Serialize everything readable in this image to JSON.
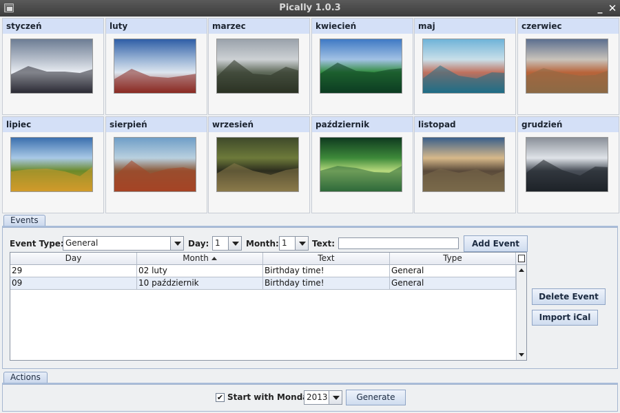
{
  "window": {
    "title": "Pically 1.0.3"
  },
  "months": [
    {
      "name": "styczeń",
      "colors": [
        "#6d7d94",
        "#b7bfcb",
        "#e9edf3",
        "#2b2b35"
      ]
    },
    {
      "name": "luty",
      "colors": [
        "#2f5ea6",
        "#9bb5d6",
        "#dde6ef",
        "#8b2a22"
      ]
    },
    {
      "name": "marzec",
      "colors": [
        "#9aa2ab",
        "#cdd1d4",
        "#5f6a5a",
        "#2c3324"
      ]
    },
    {
      "name": "kwiecień",
      "colors": [
        "#3f79c4",
        "#a2c2e4",
        "#2f8a3c",
        "#0d3d22"
      ]
    },
    {
      "name": "maj",
      "colors": [
        "#6fb3d8",
        "#c9dfe9",
        "#c0715e",
        "#1f6e86"
      ]
    },
    {
      "name": "czerwiec",
      "colors": [
        "#5c6f8f",
        "#c9c3ba",
        "#b8643a",
        "#8d6a45"
      ]
    },
    {
      "name": "lipiec",
      "colors": [
        "#3b6fae",
        "#a9c9e6",
        "#6a8a2a",
        "#d19a2a"
      ]
    },
    {
      "name": "sierpień",
      "colors": [
        "#6f9ec7",
        "#b9d0df",
        "#8b5a3a",
        "#a64425"
      ]
    },
    {
      "name": "wrzesień",
      "colors": [
        "#3f4a2a",
        "#6d7a3a",
        "#2c2d1e",
        "#8a7a4a"
      ]
    },
    {
      "name": "październik",
      "colors": [
        "#0f3a1f",
        "#3e8a3a",
        "#b7d97d",
        "#2f6a3a"
      ]
    },
    {
      "name": "listopad",
      "colors": [
        "#3a5f8a",
        "#d7b98a",
        "#5a4a3a",
        "#7a6a4a"
      ]
    },
    {
      "name": "grudzień",
      "colors": [
        "#8a9099",
        "#dfe3e8",
        "#4a5059",
        "#1e2228"
      ]
    }
  ],
  "events_tab": "Events",
  "event_form": {
    "type_label": "Event Type:",
    "type_value": "General",
    "day_label": "Day:",
    "day_value": "1",
    "month_label": "Month:",
    "month_value": "1",
    "text_label": "Text:",
    "text_value": "",
    "add_button": "Add Event"
  },
  "table": {
    "headers": [
      "Day",
      "Month",
      "Text",
      "Type"
    ],
    "sorted_column": "Month",
    "rows": [
      [
        "29",
        "02 luty",
        "Birthday time!",
        "General"
      ],
      [
        "09",
        "10 październik",
        "Birthday time!",
        "General"
      ]
    ]
  },
  "side_buttons": {
    "delete": "Delete Event",
    "import": "Import iCal"
  },
  "actions_tab": "Actions",
  "actions": {
    "start_monday_label": "Start with Monday",
    "start_monday_checked": true,
    "year_value": "2013",
    "generate_button": "Generate"
  }
}
